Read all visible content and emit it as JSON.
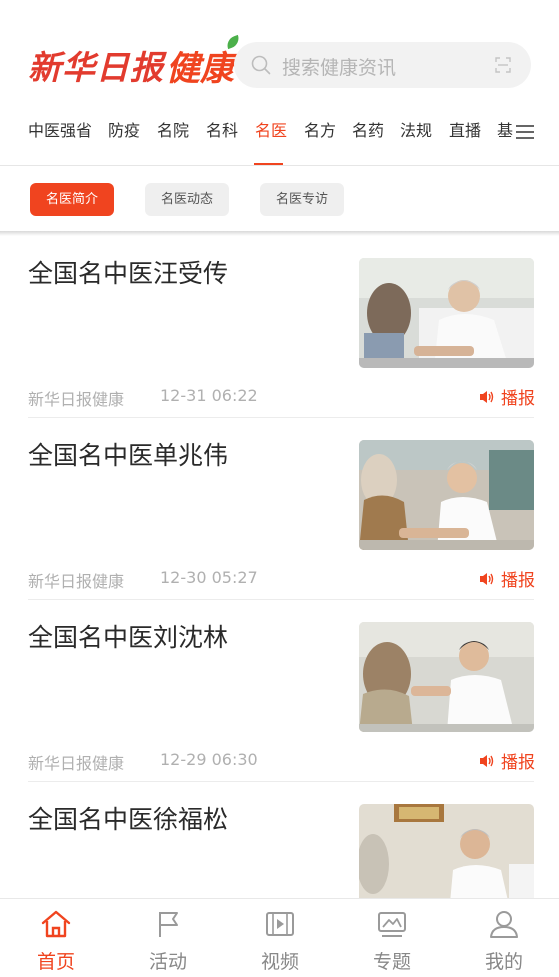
{
  "header": {
    "logo_text_brand": "新华日报",
    "logo_text_health": "健康",
    "search_placeholder": "搜索健康资讯",
    "icons": [
      "search-icon",
      "scan-icon"
    ]
  },
  "tabs": [
    {
      "label": "中医强省",
      "active": false
    },
    {
      "label": "防疫",
      "active": false
    },
    {
      "label": "名院",
      "active": false
    },
    {
      "label": "名科",
      "active": false
    },
    {
      "label": "名医",
      "active": true
    },
    {
      "label": "名方",
      "active": false
    },
    {
      "label": "名药",
      "active": false
    },
    {
      "label": "法规",
      "active": false
    },
    {
      "label": "直播",
      "active": false
    },
    {
      "label": "基",
      "active": false
    }
  ],
  "subtabs": [
    {
      "label": "名医简介",
      "active": true
    },
    {
      "label": "名医动态",
      "active": false
    },
    {
      "label": "名医专访",
      "active": false
    }
  ],
  "articles": [
    {
      "title": "全国名中医汪受传",
      "source": "新华日报健康",
      "time": "12-31 06:22",
      "action": "播报"
    },
    {
      "title": "全国名中医单兆伟",
      "source": "新华日报健康",
      "time": "12-30 05:27",
      "action": "播报"
    },
    {
      "title": "全国名中医刘沈林",
      "source": "新华日报健康",
      "time": "12-29 06:30",
      "action": "播报"
    },
    {
      "title": "全国名中医徐福松",
      "source": "",
      "time": "",
      "action": ""
    }
  ],
  "bottom_nav": [
    {
      "label": "首页",
      "icon": "home-icon",
      "active": true
    },
    {
      "label": "活动",
      "icon": "flag-icon",
      "active": false
    },
    {
      "label": "视频",
      "icon": "video-icon",
      "active": false
    },
    {
      "label": "专题",
      "icon": "topic-icon",
      "active": false
    },
    {
      "label": "我的",
      "icon": "user-icon",
      "active": false
    }
  ],
  "colors": {
    "accent": "#f0441f",
    "muted_text": "#b0b0b0",
    "chip_bg": "#efefef"
  }
}
